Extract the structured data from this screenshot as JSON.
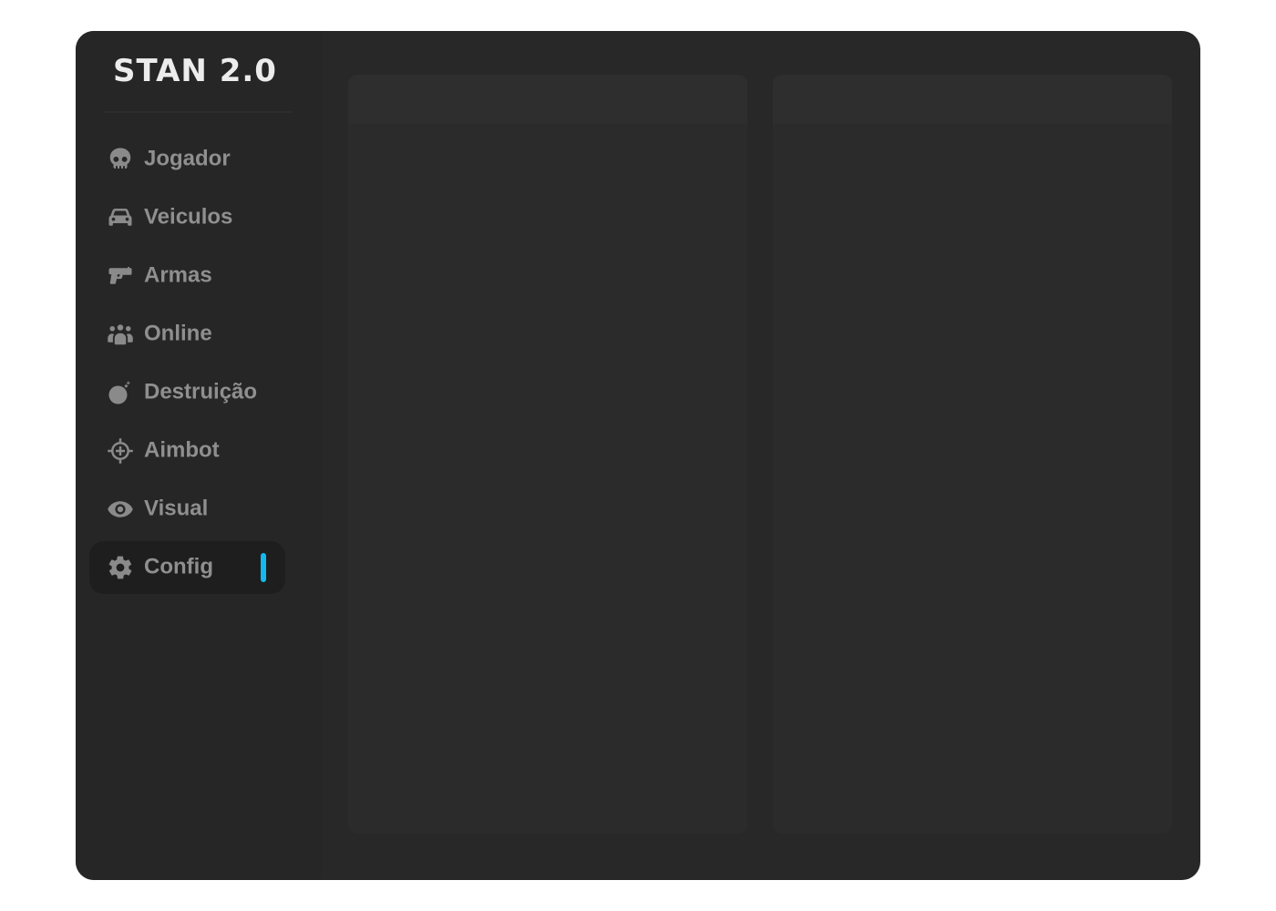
{
  "app": {
    "title": "STAN 2.0"
  },
  "sidebar": {
    "items": [
      {
        "label": "Jogador",
        "icon": "skull-icon",
        "active": false
      },
      {
        "label": "Veiculos",
        "icon": "car-icon",
        "active": false
      },
      {
        "label": "Armas",
        "icon": "gun-icon",
        "active": false
      },
      {
        "label": "Online",
        "icon": "users-icon",
        "active": false
      },
      {
        "label": "Destruição",
        "icon": "bomb-icon",
        "active": false
      },
      {
        "label": "Aimbot",
        "icon": "crosshairs-icon",
        "active": false
      },
      {
        "label": "Visual",
        "icon": "eye-icon",
        "active": false
      },
      {
        "label": "Config",
        "icon": "gear-icon",
        "active": true
      }
    ]
  },
  "colors": {
    "accent": "#14b8f0",
    "background": "#282828",
    "sidebar": "#262626",
    "panel": "#2b2b2b",
    "text_muted": "#8f8f8f",
    "title": "#ececec"
  },
  "main": {
    "panels": [
      {
        "header": ""
      },
      {
        "header": ""
      }
    ]
  }
}
